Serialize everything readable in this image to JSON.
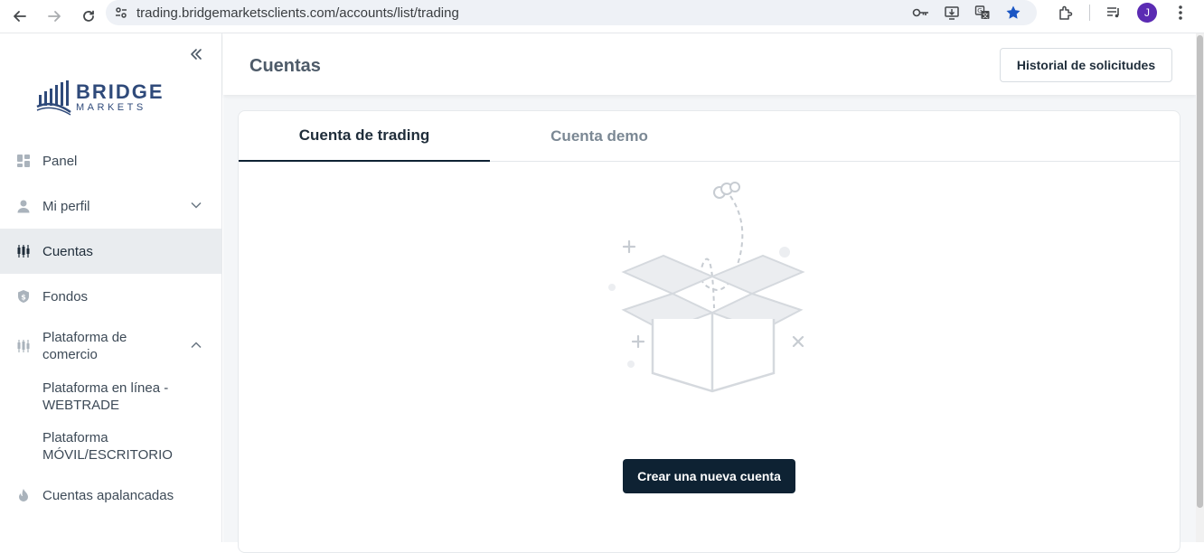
{
  "browser": {
    "url": "trading.bridgemarketsclients.com/accounts/list/trading",
    "profile_initial": "J"
  },
  "sidebar": {
    "logo": {
      "word1": "BRIDGE",
      "word2": "MARKETS"
    },
    "items": [
      {
        "label": "Panel",
        "icon": "dashboard-icon"
      },
      {
        "label": "Mi perfil",
        "icon": "user-icon"
      },
      {
        "label": "Cuentas",
        "icon": "candlestick-icon"
      },
      {
        "label": "Fondos",
        "icon": "shield-dollar-icon"
      },
      {
        "label": "Plataforma de comercio",
        "icon": "candlestick-icon"
      },
      {
        "label": "Cuentas apalancadas",
        "icon": "flame-icon"
      }
    ],
    "sub_items": [
      {
        "label": "Plataforma en línea - WEBTRADE"
      },
      {
        "label": "Plataforma MÓVIL/ESCRITORIO"
      }
    ]
  },
  "header": {
    "title": "Cuentas",
    "history_button": "Historial de solicitudes"
  },
  "tabs": [
    {
      "label": "Cuenta de trading",
      "active": true
    },
    {
      "label": "Cuenta demo",
      "active": false
    }
  ],
  "empty_state": {
    "create_button": "Crear una nueva cuenta"
  },
  "colors": {
    "primary_dark": "#0e2233",
    "brand_blue": "#2f4a7a",
    "active_bg": "#e9ecef"
  }
}
